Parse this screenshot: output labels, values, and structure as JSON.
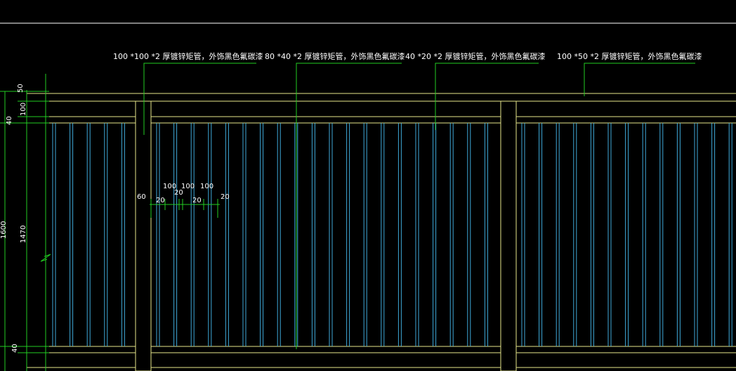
{
  "callouts": [
    {
      "text": "100 *100 *2 厚镀锌矩管，外饰黑色氟碳漆"
    },
    {
      "text": "80 *40 *2 厚镀锌矩管，外饰黑色氟碳漆"
    },
    {
      "text": "40 *20 *2 厚镀锌矩管，外饰黑色氟碳漆"
    },
    {
      "text": "100 *50 *2 厚镀锌矩管，外饰黑色氟碳漆"
    }
  ],
  "left_dims": {
    "d50": "50",
    "d40_top": "40",
    "d100": "100",
    "d1600": "1600",
    "d1470": "1470",
    "d40_bottom": "40"
  },
  "spacing_dims": {
    "d60": "60",
    "d20_a": "20",
    "d100_a": "100",
    "d20_b": "20",
    "d100_b": "100",
    "d20_c": "20",
    "d100_c": "100",
    "d20_d": "20"
  },
  "colors": {
    "background": "#000000",
    "frame": "#e6e68a",
    "bars": "#3fa9d9",
    "dimension": "#22cc22",
    "text": "#ffffff"
  }
}
